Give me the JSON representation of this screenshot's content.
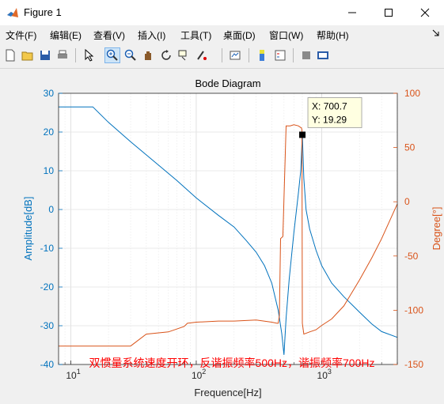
{
  "window": {
    "title": "Figure 1",
    "icon": "matlab-icon",
    "controls": [
      "minimize-icon",
      "maximize-icon",
      "close-icon"
    ]
  },
  "menu": [
    {
      "label": "文件(F)"
    },
    {
      "label": "编辑(E)"
    },
    {
      "label": "查看(V)"
    },
    {
      "label": "插入(I)"
    },
    {
      "label": "工具(T)"
    },
    {
      "label": "桌面(D)"
    },
    {
      "label": "窗口(W)"
    },
    {
      "label": "帮助(H)"
    }
  ],
  "toolbar": {
    "icons": [
      "new-figure-icon",
      "open-file-icon",
      "save-icon",
      "print-icon",
      "pointer-icon",
      "zoom-in-icon",
      "zoom-out-icon",
      "pan-icon",
      "rotate-icon",
      "data-cursor-icon",
      "brush-icon",
      "link-plot-icon",
      "colorbar-icon",
      "legend-icon",
      "hide-plot-tools-icon",
      "show-plot-tools-icon"
    ],
    "active": "zoom-in-icon"
  },
  "chart_data": {
    "type": "line",
    "title": "Bode Diagram",
    "xlabel": "Frequence[Hz]",
    "ylabel_left": "Amplitude[dB]",
    "ylabel_right": "Degree[°]",
    "xscale": "log",
    "xlim": [
      8,
      4000
    ],
    "ylim_left": [
      -40,
      30
    ],
    "ylim_right": [
      -150,
      100
    ],
    "x_ticks": [
      "10^1",
      "10^2",
      "10^3"
    ],
    "yticks_left": [
      "30",
      "20",
      "10",
      "0",
      "-10",
      "-20",
      "-30",
      "-40"
    ],
    "yticks_right": [
      "100",
      "50",
      "0",
      "-50",
      "-100",
      "-150"
    ],
    "grid": true,
    "colors": {
      "amplitude": "#0072bd",
      "phase": "#d95319",
      "annotation": "#ff0000"
    },
    "series": [
      {
        "axis": "left",
        "x": [
          8,
          15,
          20,
          30,
          50,
          70,
          100,
          150,
          200,
          250,
          300,
          350,
          400,
          450,
          480,
          500,
          520,
          550,
          600,
          650,
          680,
          700.7,
          720,
          750,
          800,
          900,
          1000,
          1200,
          1500,
          2000,
          2500,
          3000,
          4000
        ],
        "y": [
          26.5,
          26.5,
          22.5,
          17.5,
          11.5,
          7.5,
          3,
          -1.5,
          -4.5,
          -8,
          -11,
          -14.5,
          -19,
          -26,
          -32,
          -37.5,
          -28,
          -18,
          -6,
          4,
          10,
          19.29,
          8,
          0,
          -5,
          -10.5,
          -14.5,
          -19,
          -22.5,
          -26.5,
          -29.5,
          -31.5,
          -33
        ]
      },
      {
        "axis": "right",
        "x": [
          8,
          30,
          40,
          60,
          80,
          85,
          100,
          150,
          200,
          300,
          400,
          440,
          450,
          460,
          470,
          490,
          520,
          560,
          600,
          650,
          690,
          695,
          700,
          720,
          760,
          800,
          900,
          1000,
          1200,
          1500,
          2000,
          2500,
          3000,
          4000
        ],
        "y": [
          -133,
          -133,
          -122,
          -120,
          -115,
          -112,
          -111,
          -110,
          -110,
          -109,
          -111,
          -112,
          -112,
          -105,
          -34,
          -32,
          70,
          70,
          71,
          70,
          68,
          66,
          -112,
          -122,
          -121,
          -120,
          -118,
          -114,
          -108,
          -96,
          -72,
          -52,
          -34,
          -2
        ]
      }
    ],
    "datatip": {
      "x_text": "X: 700.7",
      "y_text": "Y: 19.29",
      "x": 700.7,
      "y": 19.29
    },
    "annotation": "双惯量系统速度开环，反谐振频率500Hz，谐振频率700Hz"
  }
}
